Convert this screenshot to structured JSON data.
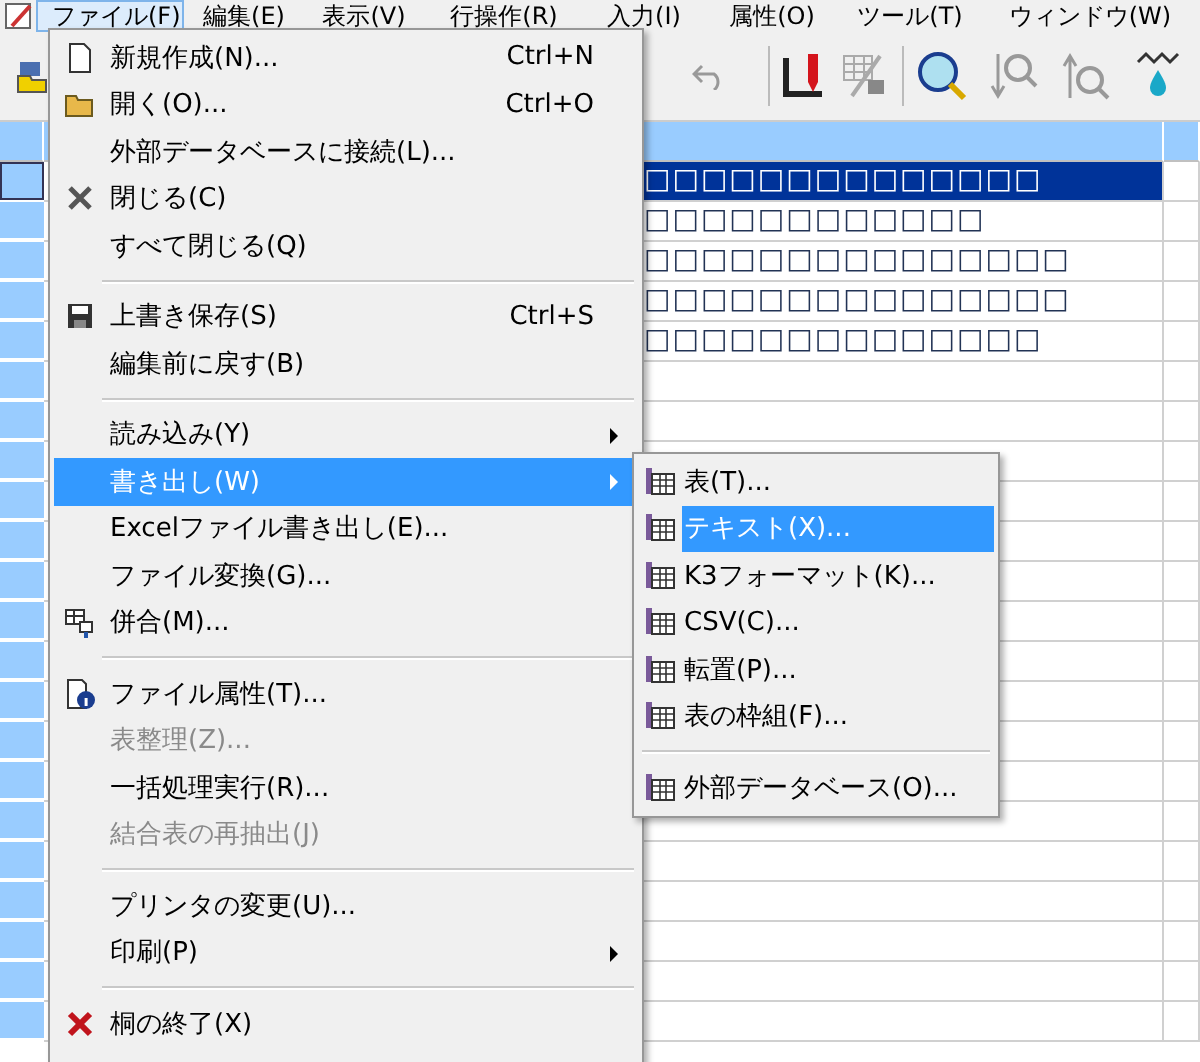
{
  "menu_bar": [
    {
      "label": "ファイル(F)",
      "selected": true
    },
    {
      "label": "編集(E)",
      "selected": false
    },
    {
      "label": "表示(V)",
      "selected": false
    },
    {
      "label": "行操作(R)",
      "selected": false
    },
    {
      "label": "入力(I)",
      "selected": false
    },
    {
      "label": "属性(O)",
      "selected": false
    },
    {
      "label": "ツール(T)",
      "selected": false
    },
    {
      "label": "ウィンドウ(W)",
      "selected": false
    }
  ],
  "sheet": {
    "rows": [
      {
        "cell": "□□□□□□□□□□□□□□",
        "selected": true
      },
      {
        "cell": "□□□□□□□□□□□□",
        "selected": false
      },
      {
        "cell": "□□□□□□□□□□□□□□□",
        "selected": false
      },
      {
        "cell": "□□□□□□□□□□□□□□□",
        "selected": false
      },
      {
        "cell": "□□□□□□□□□□□□□□",
        "selected": false
      }
    ]
  },
  "file_menu": {
    "items": [
      {
        "kind": "item",
        "label": "新規作成(N)...",
        "shortcut": "Ctrl+N",
        "disabled": false,
        "selected": false,
        "has_submenu": false
      },
      {
        "kind": "item",
        "label": "開く(O)...",
        "shortcut": "Ctrl+O",
        "disabled": false,
        "selected": false,
        "has_submenu": false
      },
      {
        "kind": "item",
        "label": "外部データベースに接続(L)...",
        "disabled": false,
        "selected": false,
        "has_submenu": false
      },
      {
        "kind": "item",
        "label": "閉じる(C)",
        "disabled": false,
        "selected": false,
        "has_submenu": false
      },
      {
        "kind": "item",
        "label": "すべて閉じる(Q)",
        "disabled": false,
        "selected": false,
        "has_submenu": false
      },
      {
        "kind": "separator"
      },
      {
        "kind": "item",
        "label": "上書き保存(S)",
        "shortcut": "Ctrl+S",
        "disabled": false,
        "selected": false,
        "has_submenu": false
      },
      {
        "kind": "item",
        "label": "編集前に戻す(B)",
        "disabled": false,
        "selected": false,
        "has_submenu": false
      },
      {
        "kind": "separator"
      },
      {
        "kind": "item",
        "label": "読み込み(Y)",
        "disabled": false,
        "selected": false,
        "has_submenu": true
      },
      {
        "kind": "item",
        "label": "書き出し(W)",
        "disabled": false,
        "selected": true,
        "has_submenu": true
      },
      {
        "kind": "item",
        "label": "Excelファイル書き出し(E)...",
        "disabled": false,
        "selected": false,
        "has_submenu": false
      },
      {
        "kind": "item",
        "label": "ファイル変換(G)...",
        "disabled": false,
        "selected": false,
        "has_submenu": false
      },
      {
        "kind": "item",
        "label": "併合(M)...",
        "disabled": false,
        "selected": false,
        "has_submenu": false
      },
      {
        "kind": "separator"
      },
      {
        "kind": "item",
        "label": "ファイル属性(T)...",
        "disabled": false,
        "selected": false,
        "has_submenu": false
      },
      {
        "kind": "item",
        "label": "表整理(Z)...",
        "disabled": true,
        "selected": false,
        "has_submenu": false
      },
      {
        "kind": "item",
        "label": "一括処理実行(R)...",
        "disabled": false,
        "selected": false,
        "has_submenu": false
      },
      {
        "kind": "item",
        "label": "結合表の再抽出(J)",
        "disabled": true,
        "selected": false,
        "has_submenu": false
      },
      {
        "kind": "separator"
      },
      {
        "kind": "item",
        "label": "プリンタの変更(U)...",
        "disabled": false,
        "selected": false,
        "has_submenu": false
      },
      {
        "kind": "item",
        "label": "印刷(P)",
        "disabled": false,
        "selected": false,
        "has_submenu": true
      },
      {
        "kind": "separator"
      },
      {
        "kind": "item",
        "label": "桐の終了(X)",
        "disabled": false,
        "selected": false,
        "has_submenu": false
      }
    ]
  },
  "export_submenu": {
    "items": [
      {
        "kind": "item",
        "label": "表(T)...",
        "selected": false
      },
      {
        "kind": "item",
        "label": "テキスト(X)...",
        "selected": true
      },
      {
        "kind": "item",
        "label": "K3フォーマット(K)...",
        "selected": false
      },
      {
        "kind": "item",
        "label": "CSV(C)...",
        "selected": false
      },
      {
        "kind": "item",
        "label": "転置(P)...",
        "selected": false
      },
      {
        "kind": "item",
        "label": "表の枠組(F)...",
        "selected": false
      },
      {
        "kind": "separator"
      },
      {
        "kind": "item",
        "label": "外部データベース(O)...",
        "selected": false
      }
    ]
  }
}
